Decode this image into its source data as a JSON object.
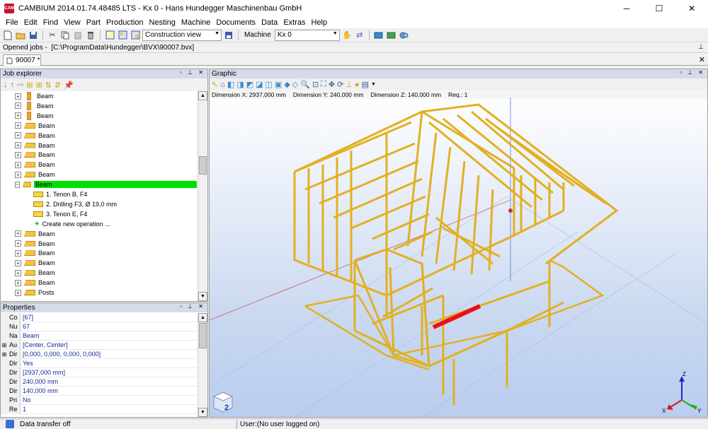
{
  "window": {
    "title": "CAMBIUM 2014.01.74.48485 LTS - Kx 0 - Hans Hundegger Maschinenbau GmbH",
    "app_icon_text": "CAM",
    "minimize": "─",
    "maximize": "☐",
    "close": "✕"
  },
  "menu": {
    "items": [
      "File",
      "Edit",
      "Find",
      "View",
      "Part",
      "Production",
      "Nesting",
      "Machine",
      "Documents",
      "Data",
      "Extras",
      "Help"
    ]
  },
  "toolbar": {
    "view_combo": "Construction view",
    "machine_label": "Machine",
    "machine_combo": "Kx 0"
  },
  "opened_jobs": {
    "label": "Opened jobs",
    "path": "[C:\\ProgramData\\Hundegger\\BVX\\90007.bvx]"
  },
  "tab": {
    "label": "90007 *"
  },
  "job_explorer": {
    "title": "Job explorer",
    "controls": "▫ ⊥ ✕",
    "rows": [
      {
        "label": "Beam",
        "kind": "vbeam"
      },
      {
        "label": "Beam",
        "kind": "vbeam"
      },
      {
        "label": "Beam",
        "kind": "vbeam"
      },
      {
        "label": "Beam",
        "kind": "beam"
      },
      {
        "label": "Beam",
        "kind": "beam"
      },
      {
        "label": "Beam",
        "kind": "beam"
      },
      {
        "label": "Beam",
        "kind": "beam"
      },
      {
        "label": "Beam",
        "kind": "beam"
      },
      {
        "label": "Beam",
        "kind": "beam"
      },
      {
        "label": "Beam",
        "kind": "selected"
      },
      {
        "label": "1. Tenon  B, F4",
        "kind": "op"
      },
      {
        "label": "2. Drilling  F3, Ø 19,0 mm",
        "kind": "op"
      },
      {
        "label": "3. Tenon  E, F4",
        "kind": "op"
      },
      {
        "label": "Create new operation ...",
        "kind": "create"
      },
      {
        "label": "Beam",
        "kind": "beam"
      },
      {
        "label": "Beam",
        "kind": "beam"
      },
      {
        "label": "Beam",
        "kind": "beam"
      },
      {
        "label": "Beam",
        "kind": "beam"
      },
      {
        "label": "Beam",
        "kind": "beam"
      },
      {
        "label": "Beam",
        "kind": "beam"
      },
      {
        "label": "Posts",
        "kind": "beam"
      }
    ]
  },
  "properties": {
    "title": "Properties",
    "controls": "▫ ⊥ ✕",
    "rows": [
      {
        "name": "Co",
        "value": "[67]",
        "expandable": false
      },
      {
        "name": "Nu",
        "value": "67",
        "expandable": false
      },
      {
        "name": "Na",
        "value": "Beam",
        "expandable": false
      },
      {
        "name": "Au",
        "value": "[Center, Center]",
        "expandable": true
      },
      {
        "name": "Dir",
        "value": "[0,000, 0,000, 0,000, 0,000]",
        "expandable": true
      },
      {
        "name": "Dir",
        "value": "Yes",
        "expandable": false
      },
      {
        "name": "Dir",
        "value": "[2937,000 mm]",
        "expandable": false
      },
      {
        "name": "Dir",
        "value": "240,000 mm",
        "expandable": false
      },
      {
        "name": "Dir",
        "value": "140,000 mm",
        "expandable": false
      },
      {
        "name": "Pri",
        "value": "No",
        "expandable": false
      },
      {
        "name": "Re",
        "value": "1",
        "expandable": false
      }
    ]
  },
  "graphic": {
    "title": "Graphic",
    "controls": "▫ ⊥ ✕",
    "dim_x": "Dimension X:  2937,000 mm",
    "dim_y": "Dimension Y:  240,000 mm",
    "dim_z": "Dimension Z:  140,000 mm",
    "req": "Req.:  1",
    "cube_label": "2",
    "axis_x": "X",
    "axis_y": "Y",
    "axis_z": "Z"
  },
  "status": {
    "left": "Data transfer off",
    "right": "User:(No user logged on)"
  },
  "colors": {
    "beam": "#f5c242",
    "selected_beam": "#e8101a",
    "selection_highlight": "#00e000",
    "panel_header": "#d6dbe9"
  }
}
